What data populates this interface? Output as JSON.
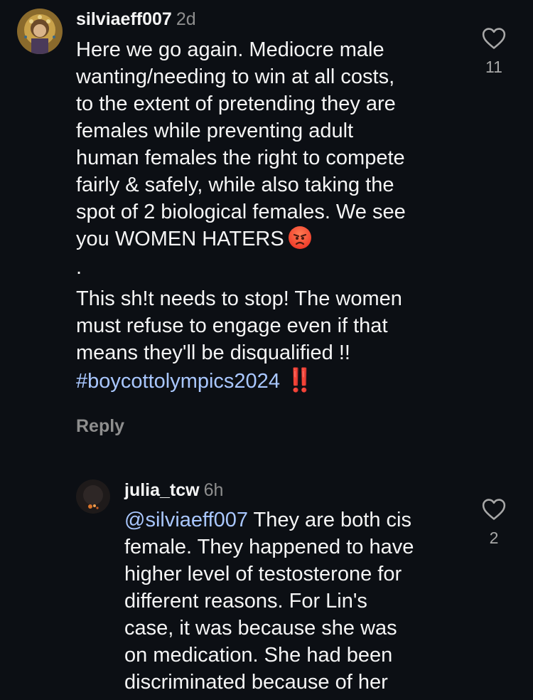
{
  "comments": [
    {
      "username": "silviaeff007",
      "time": "2d",
      "lines": [
        "Here we go again. Mediocre male",
        "wanting/needing to win at all costs,",
        "to the extent of pretending they are",
        "females while preventing adult",
        "human females the right to compete",
        "fairly & safely, while also taking the",
        "spot of 2 biological females. We see",
        "you WOMEN HATERS"
      ],
      "emoji": "angry-face-icon",
      "dot": ".",
      "para2": [
        "This sh!t needs to stop! The women",
        "must refuse to engage even if that",
        "means they'll be disqualified !!"
      ],
      "hashtag": "#boycottolympics2024",
      "hashtag_emoji": "‼️",
      "reply_label": "Reply",
      "like_count": "11"
    },
    {
      "username": "julia_tcw",
      "time": "6h",
      "mention": "@silviaeff007",
      "first_line_rest": " They are both cis",
      "lines": [
        "female. They happened to have",
        "higher level of testosterone for",
        "different reasons. For Lin's",
        "case, it was because she was",
        "on medication. She had been",
        "discriminated because of her"
      ],
      "like_count": "2"
    }
  ],
  "colors": {
    "background": "#0c0f14",
    "text": "#f5f5f5",
    "secondary": "#8e8e8e",
    "link": "#a9c7ff"
  }
}
